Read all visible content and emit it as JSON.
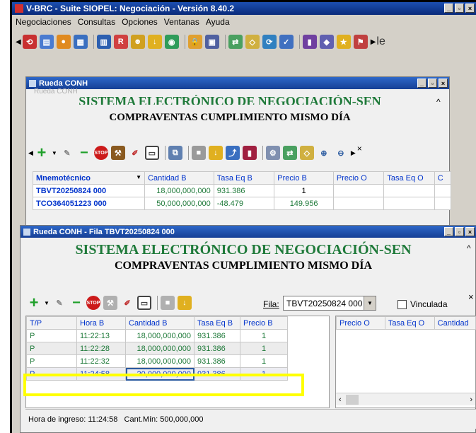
{
  "app": {
    "title": "V-BRC - Suite SIOPEL: Negociación - Versión 8.40.2",
    "trailing_text": "le"
  },
  "menu": [
    "Negociaciones",
    "Consultas",
    "Opciones",
    "Ventanas",
    "Ayuda"
  ],
  "win1": {
    "title": "Rueda CONH",
    "ghost_title": "Rueda CONH",
    "heading1": "SISTEMA ELECTRÓNICO DE NEGOCIACIÓN-SEN",
    "heading2": "COMPRAVENTAS CUMPLIMIENTO MISMO DÍA",
    "columns": [
      "Mnemotécnico",
      "Cantidad B",
      "Tasa Eq B",
      "Precio B",
      "Precio O",
      "Tasa Eq O",
      "C"
    ],
    "rows": [
      {
        "mnemo": "TBVT20250824 000",
        "cantidad_b": "18,000,000,000",
        "tasa_eq_b": "931.386",
        "precio_b": "1",
        "precio_o": "",
        "tasa_eq_o": ""
      },
      {
        "mnemo": "TCO364051223 000",
        "cantidad_b": "50,000,000,000",
        "tasa_eq_b": "-48.479",
        "precio_b": "149.956",
        "precio_o": "",
        "tasa_eq_o": ""
      }
    ]
  },
  "win2": {
    "title": "Rueda CONH - Fila TBVT20250824 000",
    "heading1": "SISTEMA ELECTRÓNICO DE NEGOCIACIÓN-SEN",
    "heading2": "COMPRAVENTAS CUMPLIMIENTO MISMO DÍA",
    "fila_label": "Fila:",
    "fila_value": "TBVT20250824 000",
    "vinculada_label": "Vinculada",
    "left_columns": [
      "T/P",
      "Hora B",
      "Cantidad B",
      "Tasa Eq B",
      "Precio B"
    ],
    "left_rows": [
      {
        "tp": "P",
        "hora": "11:22:13",
        "cantidad": "18,000,000,000",
        "tasa": "931.386",
        "precio": "1"
      },
      {
        "tp": "P",
        "hora": "11:22:28",
        "cantidad": "18,000,000,000",
        "tasa": "931.386",
        "precio": "1"
      },
      {
        "tp": "P",
        "hora": "11:22:32",
        "cantidad": "18,000,000,000",
        "tasa": "931.386",
        "precio": "1"
      },
      {
        "tp": "P",
        "hora": "11:24:58",
        "cantidad": "20,000,000,000",
        "tasa": "931.386",
        "precio": "1"
      }
    ],
    "right_columns": [
      "Precio O",
      "Tasa Eq O",
      "Cantidad"
    ],
    "status": "Hora de ingreso: 11:24:58   Cant.Mín: 500,000,000"
  },
  "colors": {
    "highlight": "#ffff00",
    "title_blue": "#0a2a7a",
    "heading_green": "#1f7a3a",
    "link_blue": "#0033cc"
  }
}
